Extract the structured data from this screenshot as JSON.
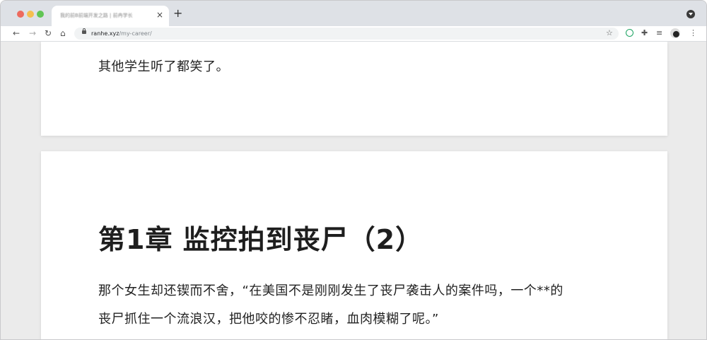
{
  "browser": {
    "tab_title": "我的前B前端开发之路 | 前冉学长",
    "tab_close": "×",
    "new_tab": "+",
    "url_host": "ranhe.xyz",
    "url_path": "/my-career/",
    "icons": [
      "back-arrow-icon",
      "forward-arrow-icon",
      "reload-icon",
      "home-icon",
      "lock-icon",
      "star-icon",
      "extension-ring-icon",
      "puzzle-icon",
      "reading-list-icon",
      "profile-avatar-icon",
      "menu-dots-icon"
    ]
  },
  "content": {
    "para1": "其他学生听了都笑了。",
    "chapter_title": "第1章 监控拍到丧尸（2）",
    "para2_line1": "那个女生却还锲而不舍，“在美国不是刚刚发生了丧尸袭击人的案件吗，一个**的",
    "para2_line2": "丧尸抓住一个流浪汉，把他咬的惨不忍睹，血肉模糊了呢。”"
  },
  "colors": {
    "tabstrip": "#dee1e6",
    "page_bg": "#ebebeb",
    "text": "#222222"
  }
}
